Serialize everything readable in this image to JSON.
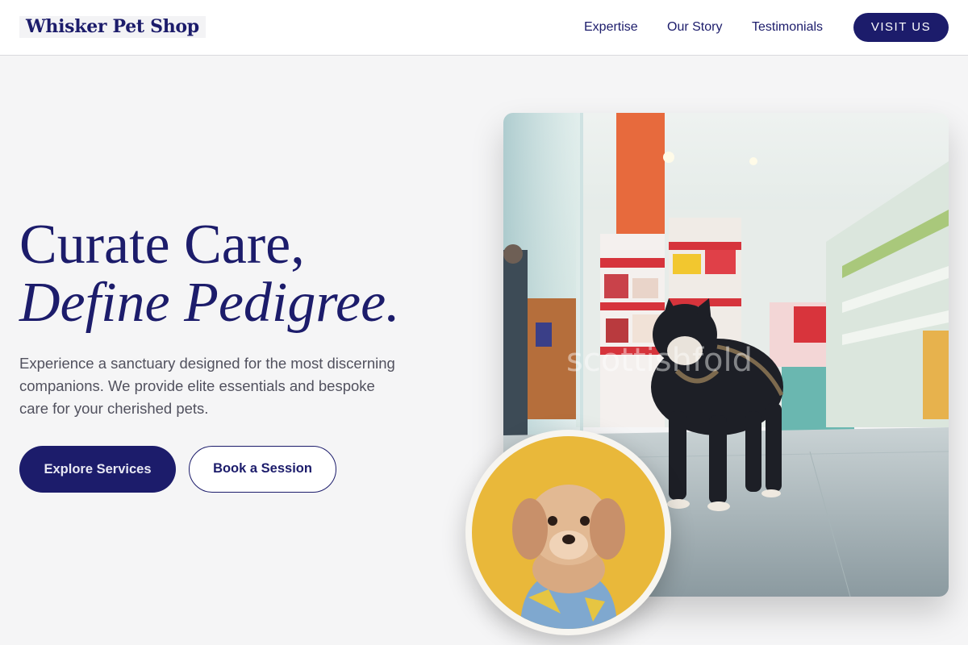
{
  "header": {
    "logo": "Whisker Pet Shop",
    "nav": [
      "Expertise",
      "Our Story",
      "Testimonials"
    ],
    "cta": "VISIT US"
  },
  "hero": {
    "title_line1": "Curate Care,",
    "title_line2": "Define Pedigree.",
    "description": "Experience a sanctuary designed for the most discerning companions. We provide elite essentials and bespoke care for your cherished pets.",
    "primary_button": "Explore Services",
    "secondary_button": "Book a Session"
  },
  "images": {
    "main": "french-bulldog-in-pet-store-photo",
    "circle": "small-dog-in-blue-shirt-photo",
    "watermark": "scottishfold"
  },
  "colors": {
    "brand": "#1c1c6b",
    "background": "#f5f5f6",
    "circle_bg": "#e9b83a"
  }
}
